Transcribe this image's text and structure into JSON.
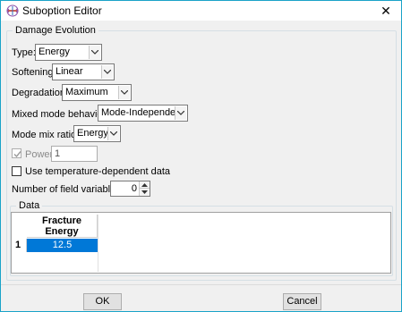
{
  "window": {
    "title": "Suboption Editor",
    "close_symbol": "✕"
  },
  "damage_evolution": {
    "group_title": "Damage Evolution",
    "type_label": "Type:",
    "type_value": "Energy",
    "softening_label": "Softening:",
    "softening_value": "Linear",
    "degradation_label": "Degradation:",
    "degradation_value": "Maximum",
    "mixed_mode_label": "Mixed mode behavior:",
    "mixed_mode_value": "Mode-Independent",
    "mode_mix_label": "Mode mix ratio:",
    "mode_mix_value": "Energy",
    "power_label": "Power",
    "power_value": "1",
    "temp_dep_label": "Use temperature-dependent data",
    "field_vars_label": "Number of field variables:",
    "field_vars_value": "0"
  },
  "data_group": {
    "group_title": "Data",
    "column_header_line1": "Fracture",
    "column_header_line2": "Energy",
    "rows": [
      {
        "row_number": "1",
        "fracture_energy": "12.5"
      }
    ]
  },
  "buttons": {
    "ok": "OK",
    "cancel": "Cancel"
  },
  "colors": {
    "accent_border": "#1aa3c8",
    "selection": "#0078d7"
  }
}
